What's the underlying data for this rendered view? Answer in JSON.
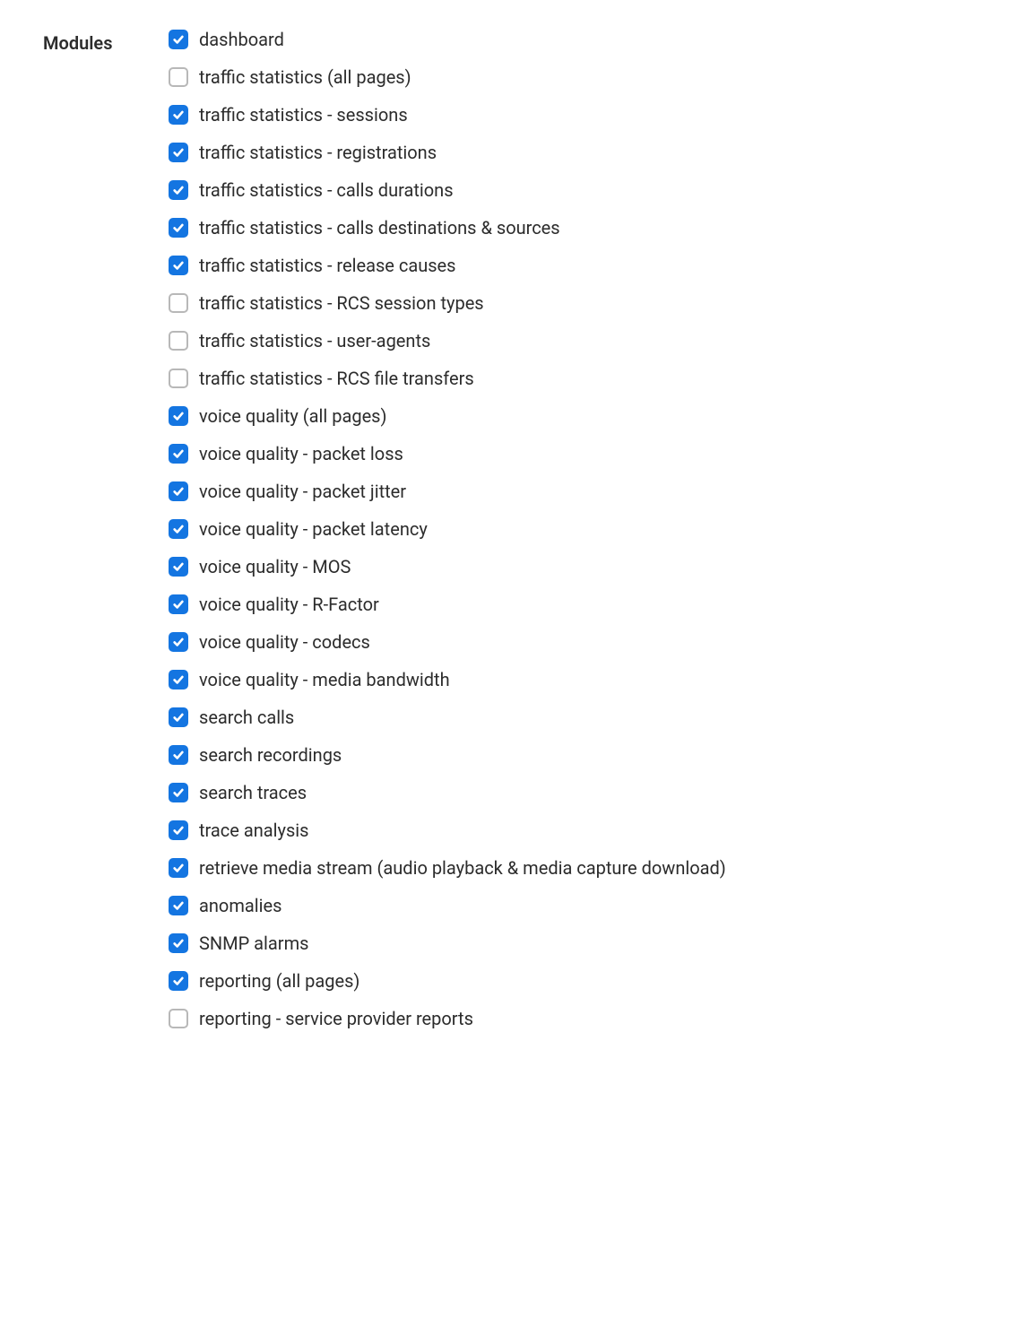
{
  "section_label": "Modules",
  "modules": [
    {
      "label": "dashboard",
      "checked": true
    },
    {
      "label": "traffic statistics (all pages)",
      "checked": false
    },
    {
      "label": "traffic statistics - sessions",
      "checked": true
    },
    {
      "label": "traffic statistics - registrations",
      "checked": true
    },
    {
      "label": "traffic statistics - calls durations",
      "checked": true
    },
    {
      "label": "traffic statistics - calls destinations & sources",
      "checked": true
    },
    {
      "label": "traffic statistics - release causes",
      "checked": true
    },
    {
      "label": "traffic statistics - RCS session types",
      "checked": false
    },
    {
      "label": "traffic statistics - user-agents",
      "checked": false
    },
    {
      "label": "traffic statistics - RCS file transfers",
      "checked": false
    },
    {
      "label": "voice quality (all pages)",
      "checked": true
    },
    {
      "label": "voice quality - packet loss",
      "checked": true
    },
    {
      "label": "voice quality - packet jitter",
      "checked": true
    },
    {
      "label": "voice quality - packet latency",
      "checked": true
    },
    {
      "label": "voice quality - MOS",
      "checked": true
    },
    {
      "label": "voice quality - R-Factor",
      "checked": true
    },
    {
      "label": "voice quality - codecs",
      "checked": true
    },
    {
      "label": "voice quality - media bandwidth",
      "checked": true
    },
    {
      "label": "search calls",
      "checked": true
    },
    {
      "label": "search recordings",
      "checked": true
    },
    {
      "label": "search traces",
      "checked": true
    },
    {
      "label": "trace analysis",
      "checked": true
    },
    {
      "label": "retrieve media stream (audio playback & media capture download)",
      "checked": true
    },
    {
      "label": "anomalies",
      "checked": true
    },
    {
      "label": "SNMP alarms",
      "checked": true
    },
    {
      "label": "reporting (all pages)",
      "checked": true
    },
    {
      "label": "reporting - service provider reports",
      "checked": false
    }
  ]
}
